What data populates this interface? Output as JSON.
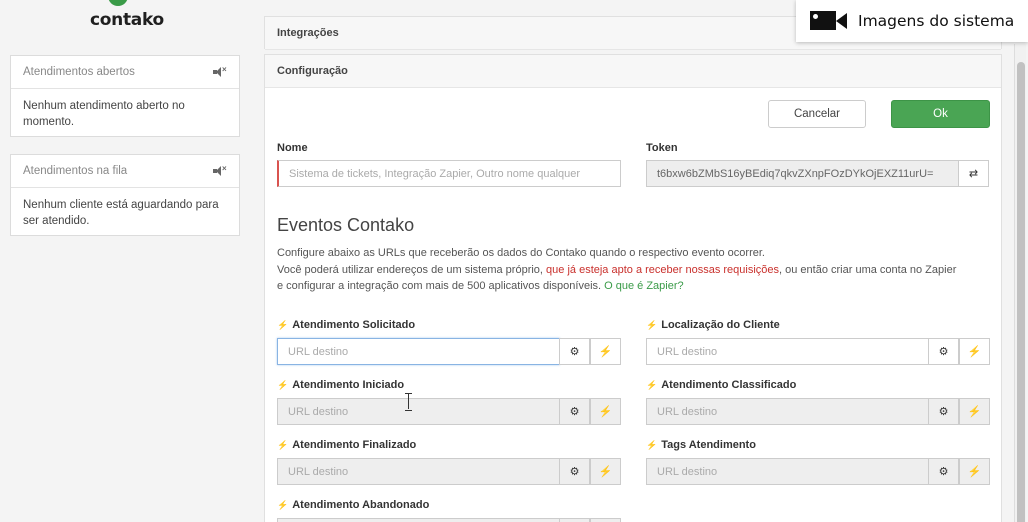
{
  "brand": {
    "name": "contako",
    "color": "#3a9b48"
  },
  "overlay": {
    "text": "Imagens do sistema",
    "icon": "video-camera-icon"
  },
  "sidebar": {
    "panels": [
      {
        "title": "Atendimentos abertos",
        "body": "Nenhum atendimento aberto no momento."
      },
      {
        "title": "Atendimentos na fila",
        "body": "Nenhum cliente está aguardando para ser atendido."
      }
    ]
  },
  "sections": {
    "integracoes": "Integrações",
    "configuracao": "Configuração"
  },
  "buttons": {
    "cancel": "Cancelar",
    "ok": "Ok"
  },
  "form": {
    "nome": {
      "label": "Nome",
      "placeholder": "Sistema de tickets, Integração Zapier, Outro nome qualquer"
    },
    "token": {
      "label": "Token",
      "value": "t6bxw6bZMbS16yBEdiq7qkvZXnpFOzDYkOjEXZ11urU="
    }
  },
  "eventos": {
    "title": "Eventos Contako",
    "desc_line1": "Configure abaixo as URLs que receberão os dados do Contako quando o respectivo evento ocorrer.",
    "desc_line2_a": "Você poderá utilizar endereços de um sistema próprio, ",
    "desc_line2_link": "que já esteja apto a receber nossas requisições",
    "desc_line2_b": ", ou então criar uma conta no Zapier",
    "desc_line3_a": "e configurar a integração com mais de 500 aplicativos disponíveis. ",
    "desc_line3_link": "O que é Zapier?",
    "url_placeholder": "URL destino",
    "items": [
      "Atendimento Solicitado",
      "Localização do Cliente",
      "Atendimento Iniciado",
      "Atendimento Classificado",
      "Atendimento Finalizado",
      "Tags Atendimento",
      "Atendimento Abandonado"
    ]
  },
  "icons": {
    "bolt": "⚡",
    "gear": "⚙",
    "refresh": "⇄"
  }
}
